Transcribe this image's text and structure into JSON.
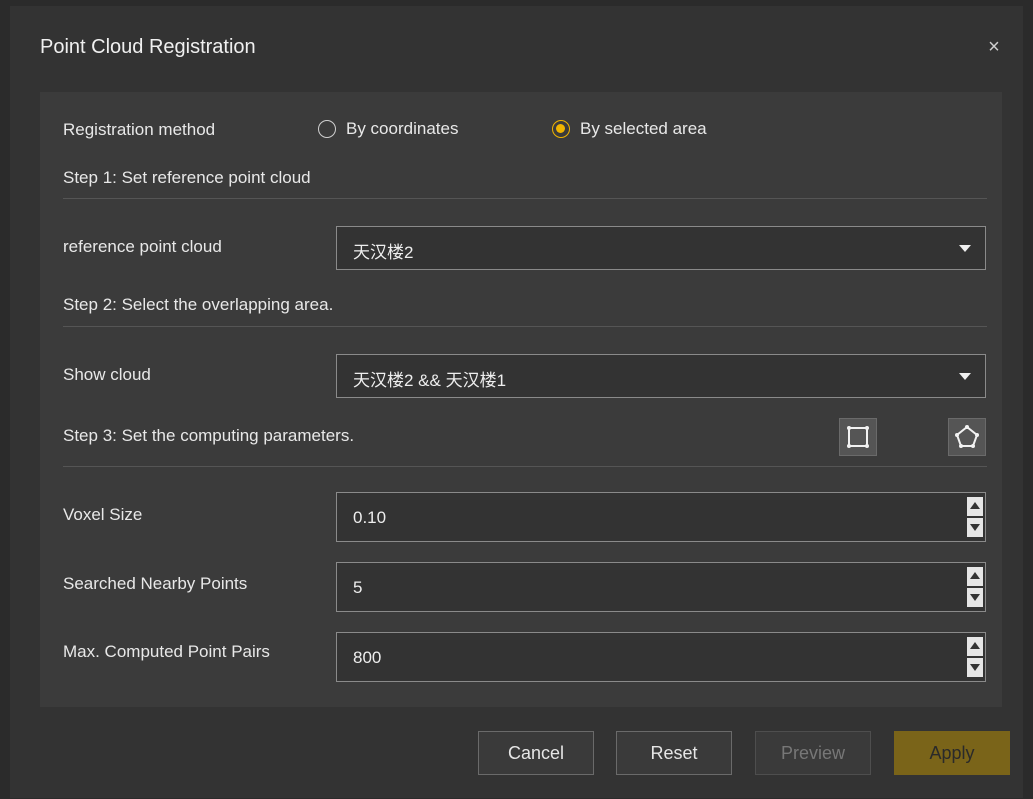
{
  "dialog": {
    "title": "Point Cloud Registration",
    "close_glyph": "×"
  },
  "registration": {
    "label": "Registration method",
    "options": [
      {
        "label": "By coordinates",
        "selected": false
      },
      {
        "label": "By selected area",
        "selected": true
      }
    ]
  },
  "step1": {
    "title": "Step 1: Set reference point cloud",
    "field_label": "reference point cloud",
    "value": "天汉楼2"
  },
  "step2": {
    "title": "Step 2: Select the overlapping area.",
    "field_label": "Show cloud",
    "value": "天汉楼2 && 天汉楼1"
  },
  "step3": {
    "title": "Step 3: Set the computing parameters.",
    "tools": [
      "rectangle-select-icon",
      "polygon-select-icon"
    ],
    "params": [
      {
        "label": "Voxel Size",
        "value": "0.10"
      },
      {
        "label": "Searched Nearby Points",
        "value": "5"
      },
      {
        "label": "Max. Computed Point Pairs",
        "value": "800"
      }
    ]
  },
  "buttons": {
    "cancel": "Cancel",
    "reset": "Reset",
    "preview": "Preview",
    "apply": "Apply"
  },
  "colors": {
    "accent": "#f0b400",
    "apply_bg": "#7a6419"
  }
}
